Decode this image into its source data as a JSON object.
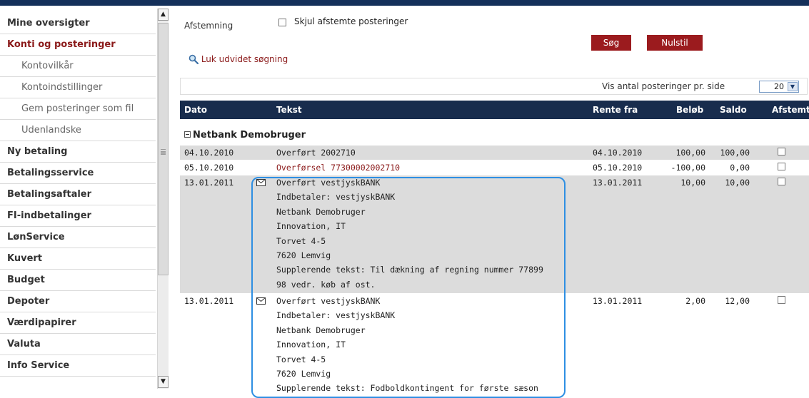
{
  "sidebar": {
    "items": [
      {
        "label": "Mine oversigter"
      },
      {
        "label": "Konti og posteringer"
      },
      {
        "label": "Kontovilkår"
      },
      {
        "label": "Kontoindstillinger"
      },
      {
        "label": "Gem posteringer som fil"
      },
      {
        "label": "Udenlandske"
      },
      {
        "label": "Ny betaling"
      },
      {
        "label": "Betalingsservice"
      },
      {
        "label": "Betalingsaftaler"
      },
      {
        "label": "FI-indbetalinger"
      },
      {
        "label": "LønService"
      },
      {
        "label": "Kuvert"
      },
      {
        "label": "Budget"
      },
      {
        "label": "Depoter"
      },
      {
        "label": "Værdipapirer"
      },
      {
        "label": "Valuta"
      },
      {
        "label": "Info Service"
      }
    ]
  },
  "filter": {
    "afstemning_label": "Afstemning",
    "hide_label": "Skjul afstemte posteringer",
    "search_button": "Søg",
    "reset_button": "Nulstil",
    "close_search_link": "Luk udvidet søgning"
  },
  "pagination": {
    "label": "Vis antal posteringer pr. side",
    "value": "20"
  },
  "table": {
    "headers": {
      "dato": "Dato",
      "tekst": "Tekst",
      "rente_fra": "Rente fra",
      "beloeb": "Beløb",
      "saldo": "Saldo",
      "afstemt": "Afstemt"
    },
    "group_name": "Netbank Demobruger",
    "rows": [
      {
        "dato": "04.10.2010",
        "lines": [
          "Overført 2002710"
        ],
        "rente_fra": "04.10.2010",
        "beloeb": "100,00",
        "saldo": "100,00"
      },
      {
        "dato": "05.10.2010",
        "lines": [
          "Overførsel 77300002002710"
        ],
        "rente_fra": "05.10.2010",
        "beloeb": "-100,00",
        "saldo": "0,00"
      },
      {
        "dato": "13.01.2011",
        "lines": [
          "Overført vestjyskBANK",
          "Indbetaler: vestjyskBANK",
          "Netbank Demobruger",
          "Innovation, IT",
          "Torvet 4-5",
          "7620  Lemvig",
          "Supplerende tekst: Til dækning af regning nummer 77899",
          "98 vedr. køb af ost."
        ],
        "rente_fra": "13.01.2011",
        "beloeb": "10,00",
        "saldo": "10,00"
      },
      {
        "dato": "13.01.2011",
        "lines": [
          "Overført vestjyskBANK",
          "Indbetaler: vestjyskBANK",
          "Netbank Demobruger",
          "Innovation, IT",
          "Torvet 4-5",
          "7620  Lemvig",
          "Supplerende tekst: Fodboldkontingent for første sæson"
        ],
        "rente_fra": "13.01.2011",
        "beloeb": "2,00",
        "saldo": "12,00"
      }
    ]
  },
  "colors": {
    "header_bg": "#182c4d",
    "accent_red": "#9b1b1e",
    "highlight_border": "#2e8fe3"
  }
}
